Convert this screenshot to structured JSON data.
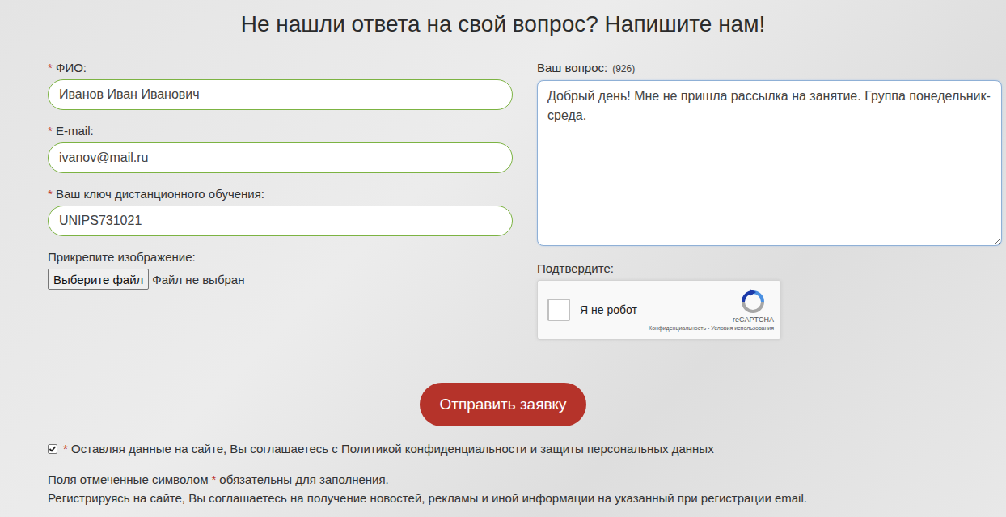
{
  "title": "Не нашли ответа на свой вопрос? Напишите нам!",
  "required_mark": "*",
  "fields": [
    {
      "label": "ФИО:",
      "required": true,
      "value": "Иванов Иван Иванович"
    },
    {
      "label": "E-mail:",
      "required": true,
      "value": "ivanov@mail.ru"
    },
    {
      "label": "Ваш ключ дистанционного обучения:",
      "required": true,
      "value": "UNIPS731021"
    }
  ],
  "file": {
    "label": "Прикрепите изображение:",
    "button": "Выберите файл",
    "status": "Файл не выбран"
  },
  "question": {
    "label": "Ваш вопрос:",
    "counter": "(926)",
    "value": "Добрый день! Мне не пришла рассылка на занятие. Группа понедельник-среда.",
    "focused": true
  },
  "captcha": {
    "label": "Подтвердите:",
    "checkbox_label": "Я не робот",
    "checked": false,
    "brand": "reCAPTCHA",
    "links": "Конфиденциальность - Условия использования"
  },
  "submit": "Отправить заявку",
  "consent": {
    "checked": true,
    "required": true,
    "text": "Оставляя данные на сайте, Вы соглашаетесь с Политикой конфиденциальности и защиты персональных данных"
  },
  "note": {
    "prefix": "Поля отмеченные символом",
    "suffix": "обязательны для заполнения."
  },
  "footer": "Регистрируясь на сайте, Вы соглашаетесь на получение новостей, рекламы и иной информации на указанный при регистрации email."
}
